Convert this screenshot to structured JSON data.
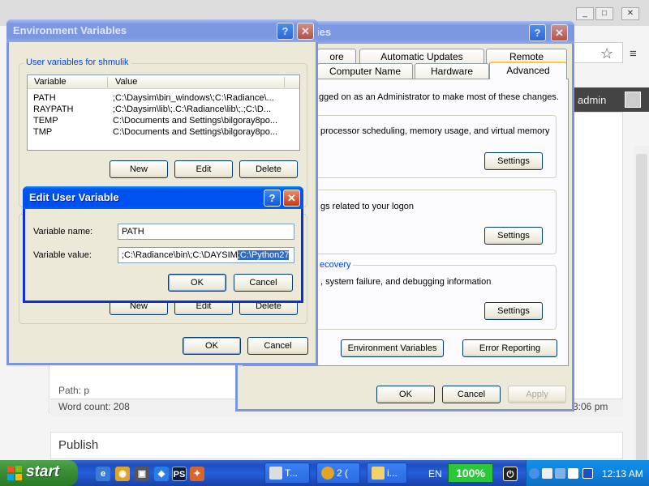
{
  "env_vars": {
    "title": "Environment Variables",
    "user_group_label": "User variables for shmulik",
    "columns": [
      "Variable",
      "Value"
    ],
    "rows": [
      {
        "name": "PATH",
        "value": ";C:\\Daysim\\bin_windows\\;C:\\Radiance\\..."
      },
      {
        "name": "RAYPATH",
        "value": ";C:\\Daysim\\lib\\;.C:\\Radiance\\lib\\;.;C:\\D..."
      },
      {
        "name": "TEMP",
        "value": "C:\\Documents and Settings\\bilgoray8po..."
      },
      {
        "name": "TMP",
        "value": "C:\\Documents and Settings\\bilgoray8po..."
      }
    ],
    "buttons": {
      "new": "New",
      "edit": "Edit",
      "delete": "Delete",
      "ok": "OK",
      "cancel": "Cancel"
    }
  },
  "edit_var": {
    "title": "Edit User Variable",
    "name_label": "Variable name:",
    "name_value": "PATH",
    "value_label": "Variable value:",
    "value_text": ";C:\\Radiance\\bin\\;C:\\DAYSIM",
    "value_selected": ";C:\\Python27",
    "ok": "OK",
    "cancel": "Cancel"
  },
  "sys_props": {
    "title_fragment": "ies",
    "tabs_row1": [
      "ore",
      "Automatic Updates",
      "Remote"
    ],
    "tabs_row2": [
      "Computer Name",
      "Hardware",
      "Advanced"
    ],
    "admin_notice": "gged on as an Administrator to make most of these changes.",
    "perf_text": "processor scheduling, memory usage, and virtual memory",
    "profile_text": "gs related to your logon",
    "recovery_label": "ecovery",
    "recovery_text": ", system failure, and debugging information",
    "settings": "Settings",
    "env_button": "Environment Variables",
    "error_button": "Error Reporting",
    "ok": "OK",
    "cancel": "Cancel",
    "apply": "Apply"
  },
  "browser": {
    "admin": "admin",
    "path": "Path: p",
    "word_count": "Word count: 208",
    "time": "3:06 pm",
    "publish": "Publish"
  },
  "taskbar": {
    "start": "start",
    "tasks": [
      "T...",
      "2 (",
      "i..."
    ],
    "lang": "EN",
    "battery": "100%",
    "clock": "12:13 AM"
  },
  "icons": [
    "help-icon",
    "close-icon",
    "minimize-icon",
    "maximize-icon",
    "star-icon",
    "menu-icon",
    "windows-logo-icon"
  ]
}
